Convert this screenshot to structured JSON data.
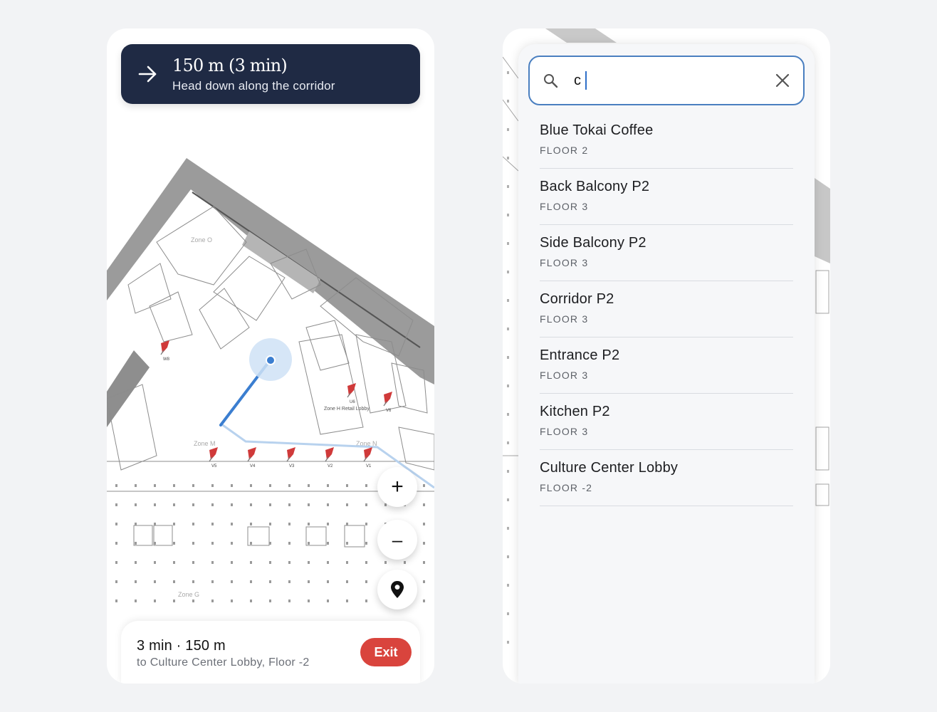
{
  "navigation": {
    "instruction_title": "150 m (3 min)",
    "instruction_detail": "Head down along the corridor",
    "summary": "3 min · 150 m",
    "destination": "to Culture Center Lobby, Floor -2",
    "exit_label": "Exit",
    "zoom_in_label": "+",
    "zoom_out_label": "–"
  },
  "map": {
    "zone_labels": [
      "Zone O",
      "Zone M",
      "Zone N",
      "Zone G",
      "Zone H Retail Lobby"
    ],
    "marker_labels": [
      "V5",
      "V4",
      "V3",
      "V2",
      "V1",
      "V6",
      "W8",
      "U6"
    ],
    "route_color": "#3b7ed0",
    "marker_color": "#d03a3a"
  },
  "search": {
    "query": "c",
    "results": [
      {
        "name": "Blue Tokai Coffee",
        "floor": "FLOOR 2"
      },
      {
        "name": "Back Balcony P2",
        "floor": "FLOOR 3"
      },
      {
        "name": "Side Balcony P2",
        "floor": "FLOOR 3"
      },
      {
        "name": "Corridor P2",
        "floor": "FLOOR 3"
      },
      {
        "name": "Entrance P2",
        "floor": "FLOOR 3"
      },
      {
        "name": "Kitchen P2",
        "floor": "FLOOR 3"
      },
      {
        "name": "Culture Center Lobby",
        "floor": "FLOOR -2"
      }
    ]
  },
  "colors": {
    "banner_bg": "#1f2a44",
    "exit_bg": "#d9443d",
    "search_border": "#4a7fc0"
  }
}
